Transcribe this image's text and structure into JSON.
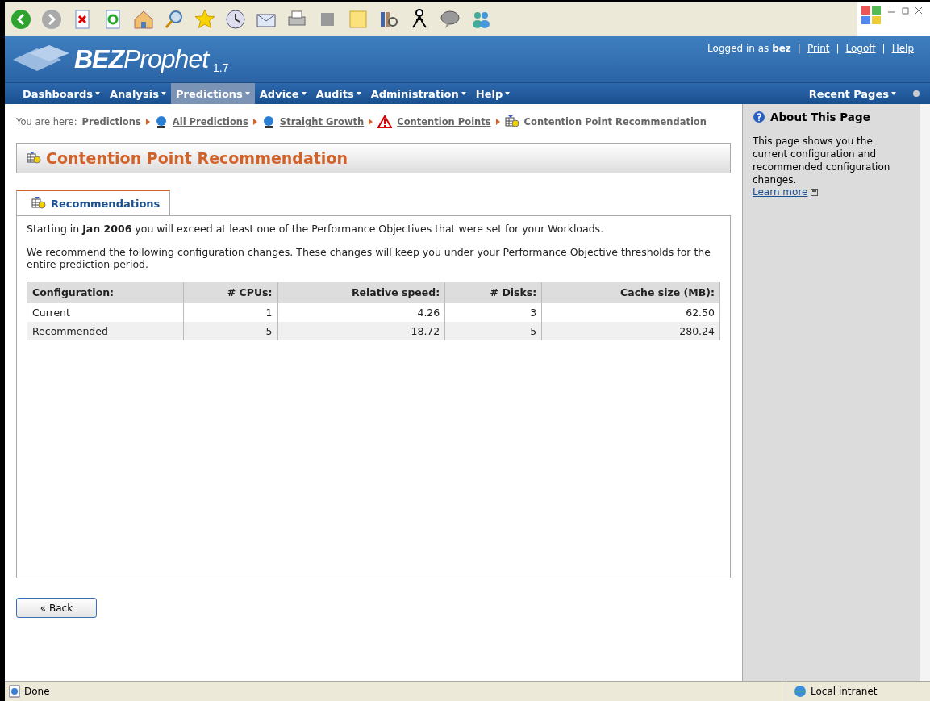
{
  "header": {
    "logo_bold": "BEZ",
    "logo_rest": "Prophet",
    "version": "1.7",
    "login": "Logged in as **bez**",
    "separator": "|",
    "links": [
      "Print",
      "Logoff",
      "Help"
    ]
  },
  "nav": {
    "items": [
      {
        "label": "Dashboards",
        "selected": false
      },
      {
        "label": "Analysis",
        "selected": false
      },
      {
        "label": "Predictions",
        "selected": true
      },
      {
        "label": "Advice",
        "selected": false
      },
      {
        "label": "Audits",
        "selected": false
      },
      {
        "label": "Administration",
        "selected": false
      },
      {
        "label": "Help",
        "selected": false
      }
    ],
    "recent": "Recent Pages"
  },
  "breadcrumb": {
    "prefix": "You are here:",
    "items": [
      {
        "label": "Predictions",
        "kind": "plain"
      },
      {
        "label": "All Predictions",
        "kind": "globe"
      },
      {
        "label": "Straight Growth",
        "kind": "globe"
      },
      {
        "label": "Contention Points",
        "kind": "warning"
      },
      {
        "label": "Contention Point Recommendation",
        "kind": "current"
      }
    ]
  },
  "page_title": "Contention Point Recommendation",
  "tabs": [
    {
      "label": "Recommendations",
      "selected": true
    }
  ],
  "paragraphs": [
    "Starting in **Jan 2006** you will exceed at least one of the Performance Objectives that were set for your Workloads.",
    "We recommend the following configuration changes. These changes will keep you under your Performance Objective thresholds for the entire prediction period."
  ],
  "table": {
    "columns": [
      "Configuration:",
      "# CPUs:",
      "Relative speed:",
      "# Disks:",
      "Cache size (MB):"
    ],
    "rows": [
      [
        "Current",
        "1",
        "4.26",
        "3",
        "62.50"
      ],
      [
        "Recommended",
        "5",
        "18.72",
        "5",
        "280.24"
      ]
    ]
  },
  "back_button": "« Back",
  "sidebar": {
    "title": "About This Page",
    "text": "This page shows you the current configuration and recommended configuration changes.",
    "link": "Learn more"
  },
  "status_bar": {
    "text": "Done",
    "zone": "Local intranet"
  }
}
